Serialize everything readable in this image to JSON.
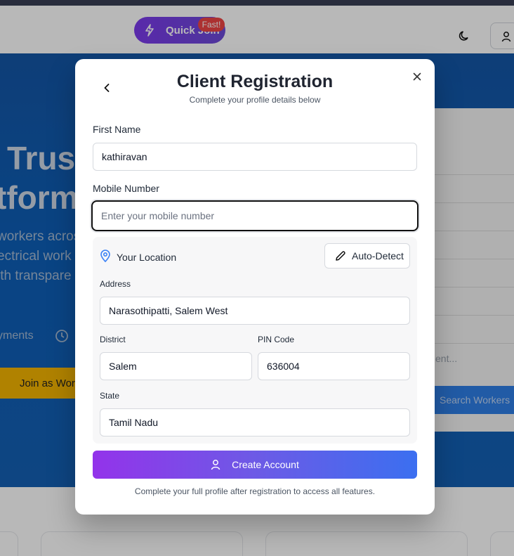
{
  "background": {
    "quick_join": "Quick Join",
    "fast_badge": "Fast!",
    "hero_title_line1": "Trust",
    "hero_title_line2": "tform",
    "hero_sub_line1": "workers acros",
    "hero_sub_line2": "ectrical work",
    "hero_sub_line3": "ith transpare",
    "hero_payments": "yments",
    "join_worker": "Join as Work",
    "right_placeholder": "ent...",
    "search_workers": "Search Workers"
  },
  "modal": {
    "title": "Client Registration",
    "subtitle": "Complete your profile details below",
    "first_name": {
      "label": "First Name",
      "value": "kathiravan"
    },
    "mobile": {
      "label": "Mobile Number",
      "placeholder": "Enter your mobile number",
      "value": ""
    },
    "location": {
      "title": "Your Location",
      "auto_detect": "Auto-Detect",
      "address": {
        "label": "Address",
        "value": "Narasothipatti, Salem West"
      },
      "district": {
        "label": "District",
        "value": "Salem"
      },
      "pin": {
        "label": "PIN Code",
        "value": "636004"
      },
      "state": {
        "label": "State",
        "value": "Tamil Nadu"
      }
    },
    "create_button": "Create Account",
    "footnote": "Complete your full profile after registration to access all features."
  },
  "colors": {
    "accent_gradient_start": "#9333ea",
    "accent_gradient_end": "#3b6ff0",
    "location_pin": "#3b82f6"
  },
  "icons": [
    "lightning-icon",
    "moon-icon",
    "user-icon",
    "clock-icon",
    "chevron-left-icon",
    "close-icon",
    "map-pin-icon",
    "pencil-icon"
  ]
}
